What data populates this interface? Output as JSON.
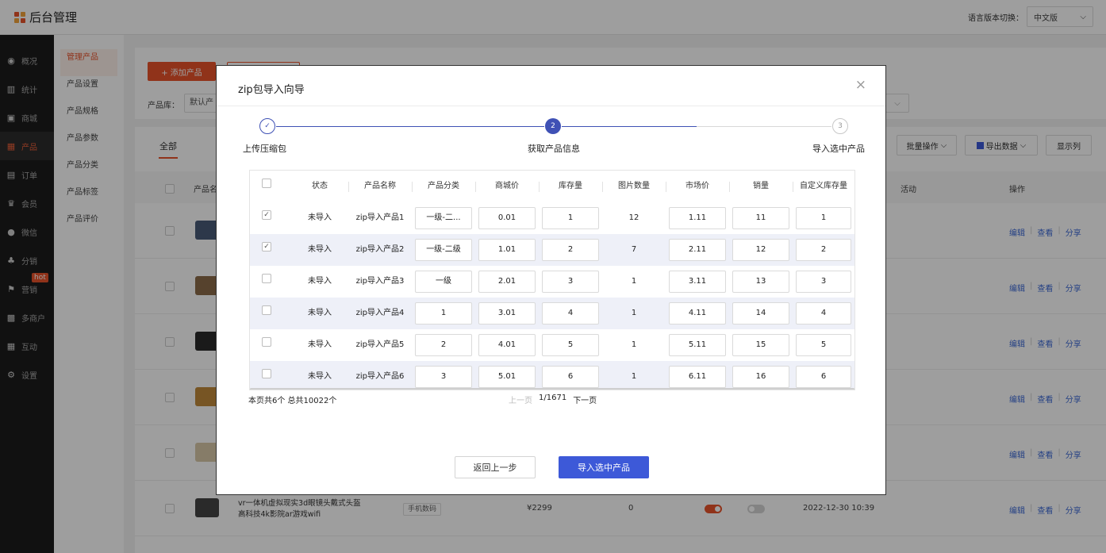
{
  "header": {
    "title": "后台管理",
    "logo_colors": [
      "#e8532b",
      "#f2a33a",
      "#e8532b",
      "#f2a33a"
    ],
    "lang_label": "语言版本切换：",
    "lang_value": "中文版"
  },
  "sidenav": {
    "items": [
      {
        "label": "概况",
        "icon": "eye-icon"
      },
      {
        "label": "统计",
        "icon": "chart-icon"
      },
      {
        "label": "商城",
        "icon": "shop-icon"
      },
      {
        "label": "产品",
        "icon": "product-icon",
        "active": true
      },
      {
        "label": "订单",
        "icon": "order-icon"
      },
      {
        "label": "会员",
        "icon": "crown-icon"
      },
      {
        "label": "微信",
        "icon": "wechat-icon"
      },
      {
        "label": "分销",
        "icon": "distribution-icon"
      },
      {
        "label": "营销",
        "icon": "flag-icon",
        "badge": "hot"
      },
      {
        "label": "多商户",
        "icon": "merchant-icon"
      },
      {
        "label": "互动",
        "icon": "interact-icon"
      },
      {
        "label": "设置",
        "icon": "gear-icon"
      }
    ]
  },
  "subnav": {
    "items": [
      "管理产品",
      "产品设置",
      "产品规格",
      "产品参数",
      "产品分类",
      "产品标签",
      "产品评价"
    ]
  },
  "page": {
    "add_button": "+ 添加产品",
    "lib_label": "产品库：",
    "lib_value": "默认产",
    "tab_all": "全部",
    "batch_button": "批量操作",
    "export_button": "导出数据",
    "display_button": "显示列",
    "col_name": "产品名",
    "col_activity": "活动",
    "col_ops": "操作",
    "op_edit": "编辑",
    "op_view": "查看",
    "op_share": "分享",
    "bg_product_name": "vr一体机虚拟现实3d眼镜头戴式头盔高科技4k影院ar游戏wifi",
    "bg_product_tag": "手机数码",
    "bg_product_price": "¥2299",
    "bg_product_stock": "0",
    "bg_product_date": "2022-12-30 10:39"
  },
  "modal": {
    "title": "zip包导入向导",
    "close": "×",
    "accent": "#3f51b5",
    "steps": [
      {
        "num": "✓",
        "label": "上传压缩包"
      },
      {
        "num": "2",
        "label": "获取产品信息"
      },
      {
        "num": "3",
        "label": "导入选中产品"
      }
    ],
    "columns": [
      "状态",
      "产品名称",
      "产品分类",
      "商城价",
      "库存量",
      "图片数量",
      "市场价",
      "销量",
      "自定义库存量"
    ],
    "rows": [
      {
        "checked": "✓",
        "status": "未导入",
        "name": "zip导入产品1",
        "category": "一级-二...",
        "price": "0.01",
        "stock": "1",
        "images": "12",
        "market": "1.11",
        "sales": "11",
        "custom": "1"
      },
      {
        "checked": "✓",
        "status": "未导入",
        "name": "zip导入产品2",
        "category": "一级-二级",
        "price": "1.01",
        "stock": "2",
        "images": "7",
        "market": "2.11",
        "sales": "12",
        "custom": "2"
      },
      {
        "checked": "",
        "status": "未导入",
        "name": "zip导入产品3",
        "category": "一级",
        "price": "2.01",
        "stock": "3",
        "images": "1",
        "market": "3.11",
        "sales": "13",
        "custom": "3"
      },
      {
        "checked": "",
        "status": "未导入",
        "name": "zip导入产品4",
        "category": "1",
        "price": "3.01",
        "stock": "4",
        "images": "1",
        "market": "4.11",
        "sales": "14",
        "custom": "4"
      },
      {
        "checked": "",
        "status": "未导入",
        "name": "zip导入产品5",
        "category": "2",
        "price": "4.01",
        "stock": "5",
        "images": "1",
        "market": "5.11",
        "sales": "15",
        "custom": "5"
      },
      {
        "checked": "",
        "status": "未导入",
        "name": "zip导入产品6",
        "category": "3",
        "price": "5.01",
        "stock": "6",
        "images": "1",
        "market": "6.11",
        "sales": "16",
        "custom": "6"
      }
    ],
    "pagination": {
      "summary": "本页共6个  总共10022个",
      "prev": "上一页",
      "page": "1/1671",
      "next": "下一页"
    },
    "back_button": "返回上一步",
    "import_button": "导入选中产品"
  }
}
